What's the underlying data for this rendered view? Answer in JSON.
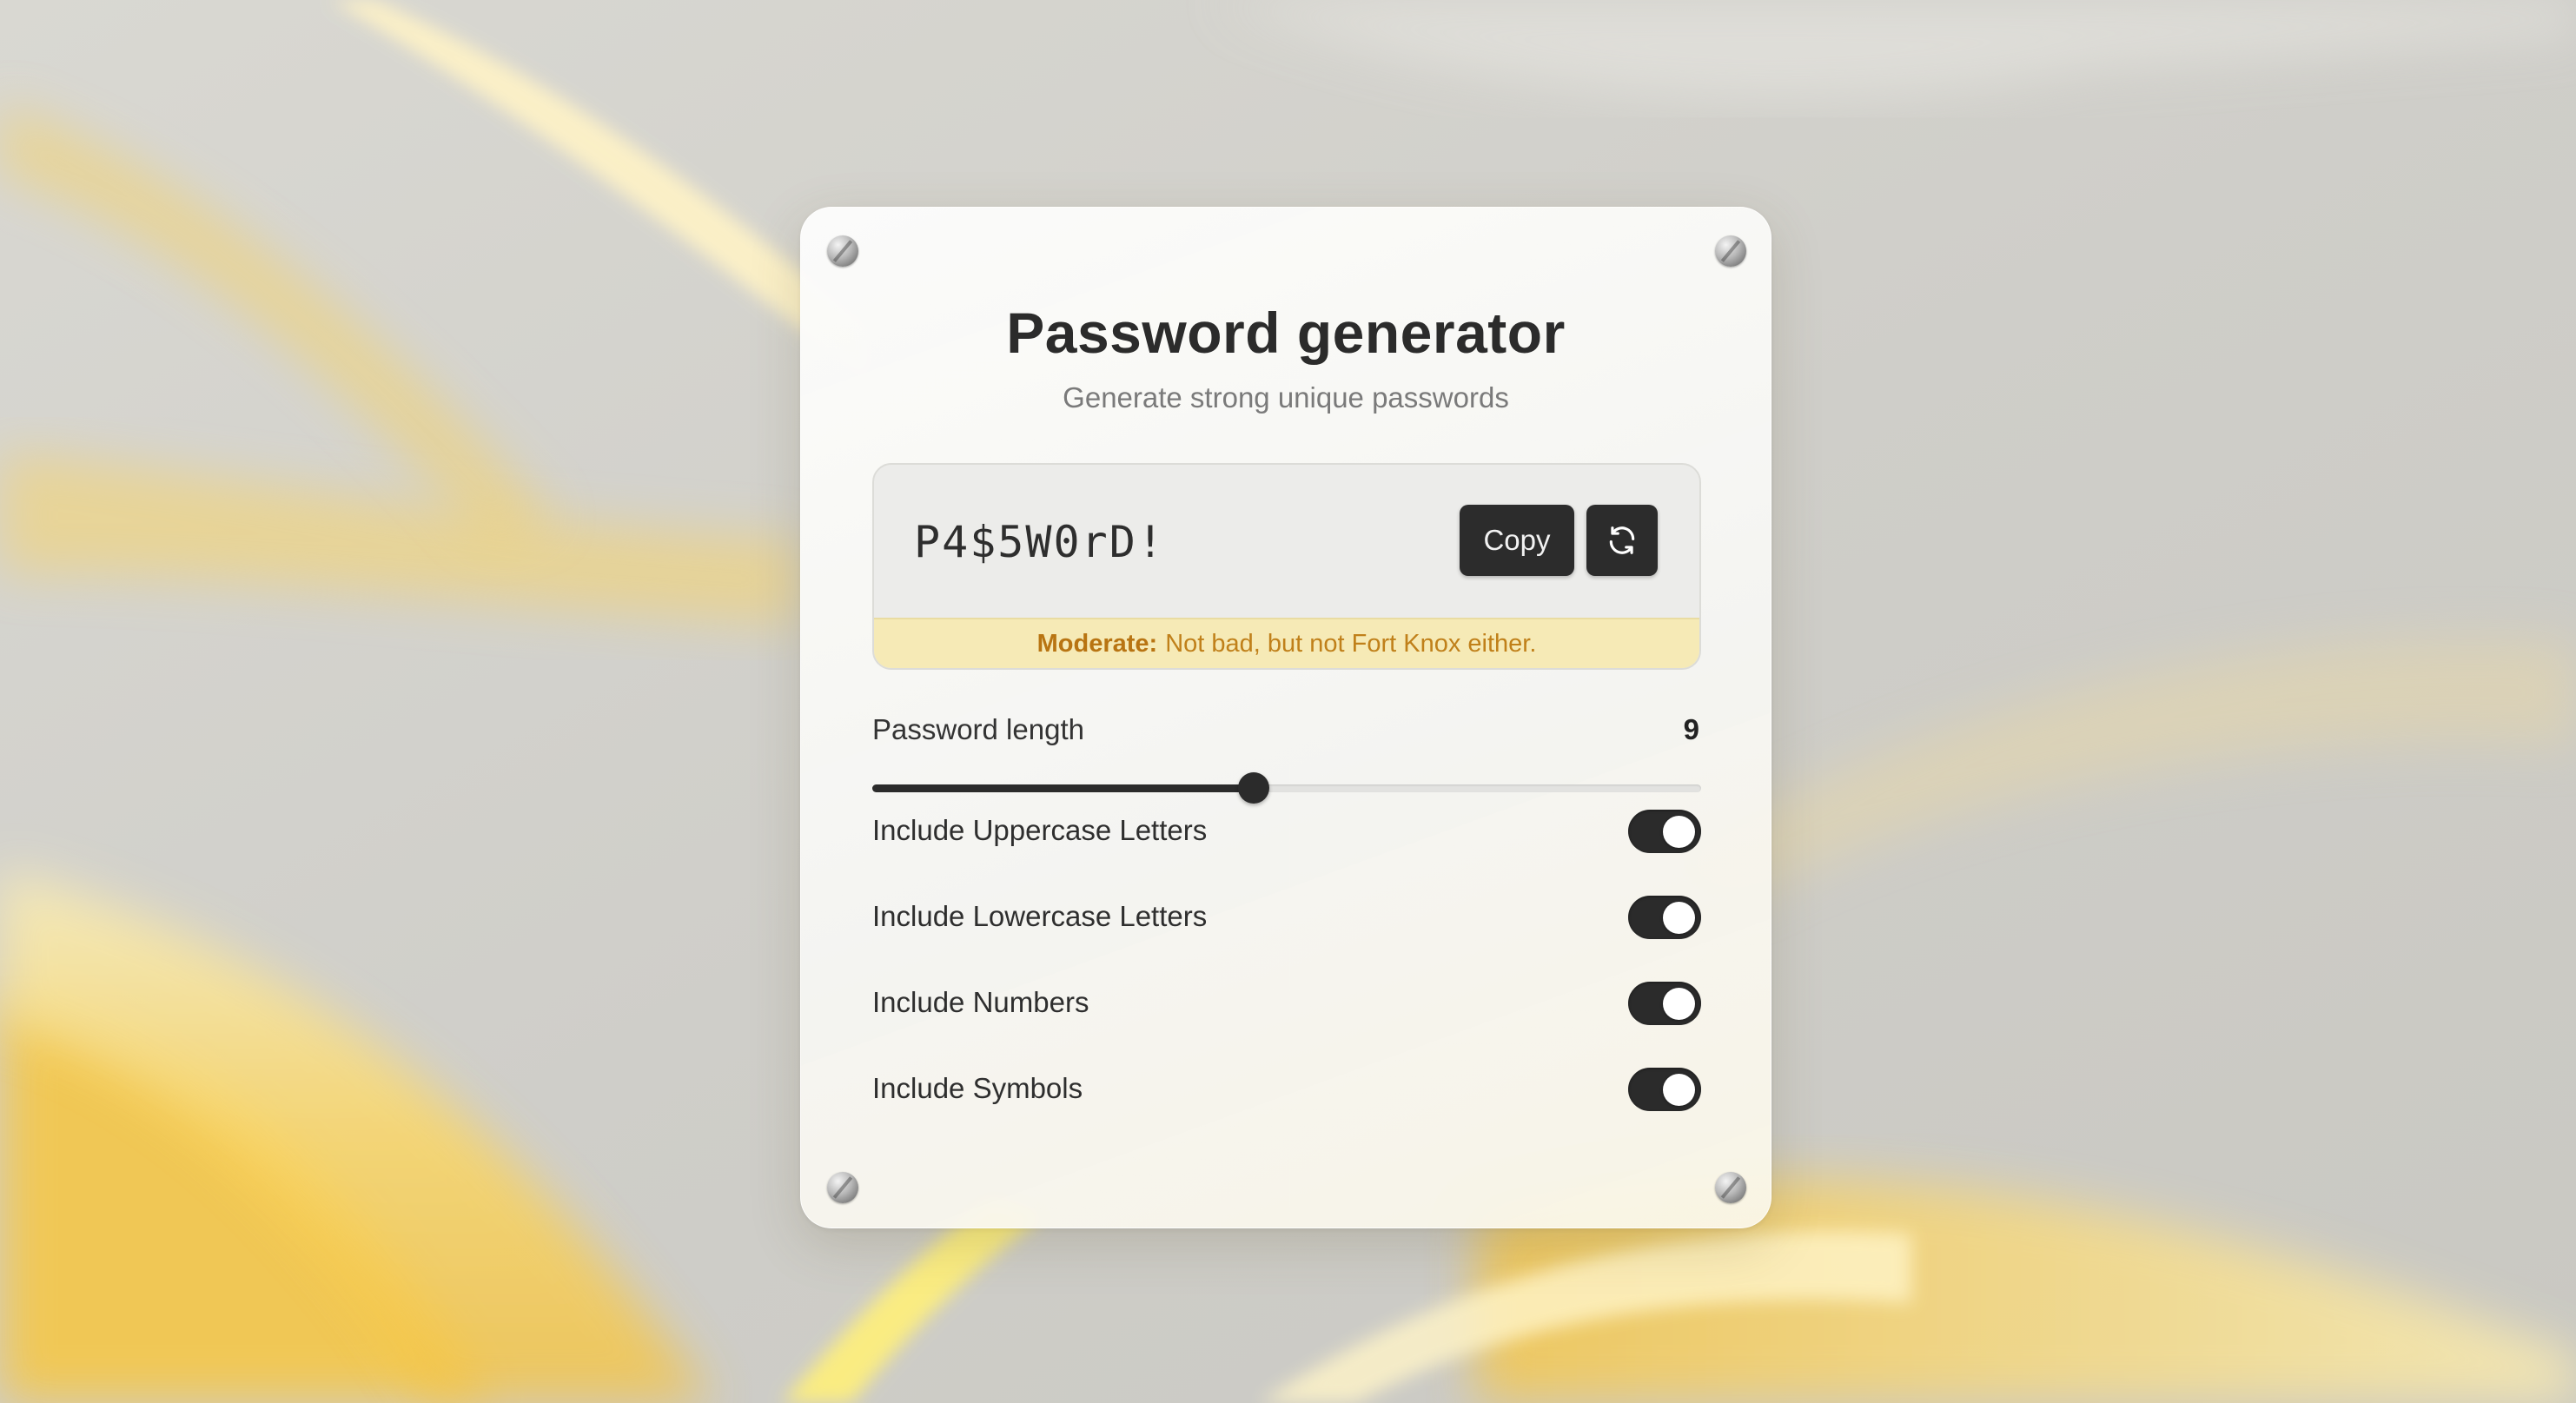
{
  "app": {
    "title": "Password generator",
    "subtitle": "Generate strong unique passwords"
  },
  "password": {
    "value": "P4$5W0rD!",
    "copy_label": "Copy",
    "refresh_icon": "refresh-icon",
    "strength_level": "Moderate:",
    "strength_message": "Not bad, but not Fort Knox either.",
    "strength_color": "#b87412",
    "strength_bg": "#f6eab6"
  },
  "length": {
    "label": "Password length",
    "value": "9",
    "slider_fraction": 0.46
  },
  "options": [
    {
      "label": "Include Uppercase Letters",
      "enabled": true
    },
    {
      "label": "Include Lowercase Letters",
      "enabled": true
    },
    {
      "label": "Include Numbers",
      "enabled": true
    },
    {
      "label": "Include Symbols",
      "enabled": true
    }
  ],
  "colors": {
    "accent": "#2b2b2b",
    "card": "#f6f6f3"
  }
}
